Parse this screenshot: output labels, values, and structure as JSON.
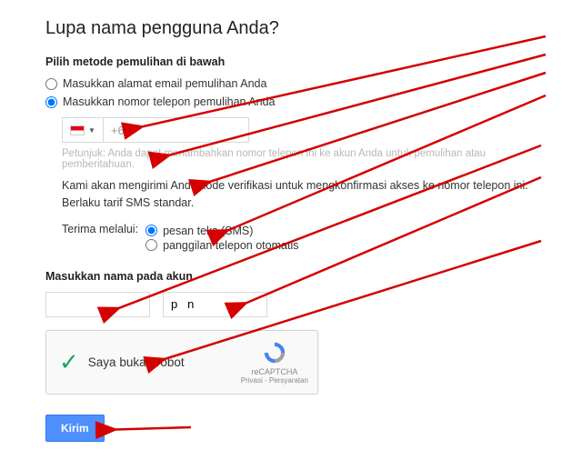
{
  "heading": "Lupa nama pengguna Anda?",
  "method": {
    "title": "Pilih metode pemulihan di bawah",
    "email_label": "Masukkan alamat email pemulihan Anda",
    "phone_label": "Masukkan nomor telepon pemulihan Anda"
  },
  "phone": {
    "prefix": "+62",
    "hint": "Petunjuk: Anda dapat menambahkan nomor telepon ini ke akun Anda untuk pemulihan atau pemberitahuan.",
    "desc_line1": "Kami akan mengirimi Anda kode verifikasi untuk mengkonfirmasi akses ke nomor telepon ini.",
    "desc_line2": "Berlaku tarif SMS standar."
  },
  "receive": {
    "label": "Terima melalui:",
    "sms": "pesan teks (SMS)",
    "call": "panggilan telepon otomatis"
  },
  "name": {
    "title": "Masukkan nama pada akun",
    "first": "",
    "last_fragment": "p   n"
  },
  "recaptcha": {
    "label": "Saya bukan robot",
    "brand": "reCAPTCHA",
    "links": "Privasi - Persyaratan"
  },
  "submit": "Kirim"
}
